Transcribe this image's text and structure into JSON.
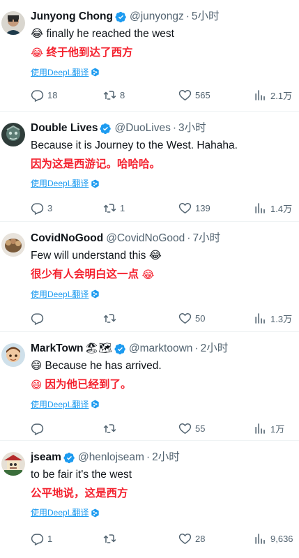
{
  "colors": {
    "accent": "#1d9bf0",
    "translation": "#f4212e",
    "secondary": "#536471",
    "text": "#0f1419"
  },
  "translate_label": "使用DeepL翻译",
  "tweets": [
    {
      "name": "Junyong Chong",
      "handle": "@junyongz",
      "sep": "·",
      "time": "5小时",
      "text": "finally he reached the west",
      "text_emoji": "😂",
      "translation": "终于他到达了西方",
      "translation_emoji": "😂",
      "replies": "18",
      "retweets": "8",
      "likes": "565",
      "views": "2.1万"
    },
    {
      "name": "Double Lives",
      "handle": "@DuoLives",
      "sep": "·",
      "time": "3小时",
      "text": "Because it is Journey to the West. Hahaha.",
      "translation": "因为这是西游记。哈哈哈。",
      "replies": "3",
      "retweets": "1",
      "likes": "139",
      "views": "1.4万"
    },
    {
      "name": "CovidNoGood",
      "handle": "@CovidNoGood",
      "sep": "·",
      "time": "7小时",
      "text": "Few will understand this",
      "text_emoji": "😂",
      "translation": "很少有人会明白这一点",
      "translation_emoji": "😂",
      "replies": "",
      "retweets": "",
      "likes": "50",
      "views": "1.3万"
    },
    {
      "name": "MarkTown",
      "name_emojis": "🏖🗺",
      "handle": "@marktoown",
      "sep": "·",
      "time": "2小时",
      "text": "Because he has arrived.",
      "text_emoji": "😄",
      "translation": "因为他已经到了。",
      "translation_emoji": "😄",
      "replies": "",
      "retweets": "",
      "likes": "55",
      "views": "1万"
    },
    {
      "name": "jseam",
      "handle": "@henlojseam",
      "sep": "·",
      "time": "2小时",
      "text": "to be fair it's the west",
      "translation": "公平地说，这是西方",
      "replies": "1",
      "retweets": "",
      "likes": "28",
      "views": "9,636"
    }
  ]
}
